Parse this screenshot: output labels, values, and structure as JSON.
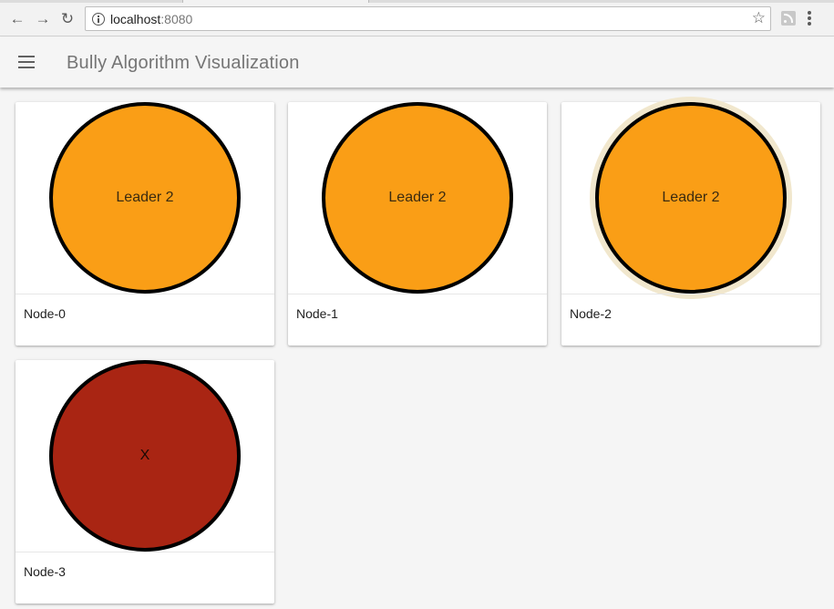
{
  "browser": {
    "url_host": "localhost",
    "url_port": ":8080"
  },
  "app": {
    "title": "Bully Algorithm Visualization"
  },
  "colors": {
    "alive": "#fa9e16",
    "dead": "#a92513",
    "highlight": "#f1e7cd"
  },
  "nodes": [
    {
      "label": "Node-0",
      "state_text": "Leader 2",
      "status": "alive",
      "highlighted": false
    },
    {
      "label": "Node-1",
      "state_text": "Leader 2",
      "status": "alive",
      "highlighted": false
    },
    {
      "label": "Node-2",
      "state_text": "Leader 2",
      "status": "alive",
      "highlighted": true
    },
    {
      "label": "Node-3",
      "state_text": "X",
      "status": "dead",
      "highlighted": false
    }
  ]
}
